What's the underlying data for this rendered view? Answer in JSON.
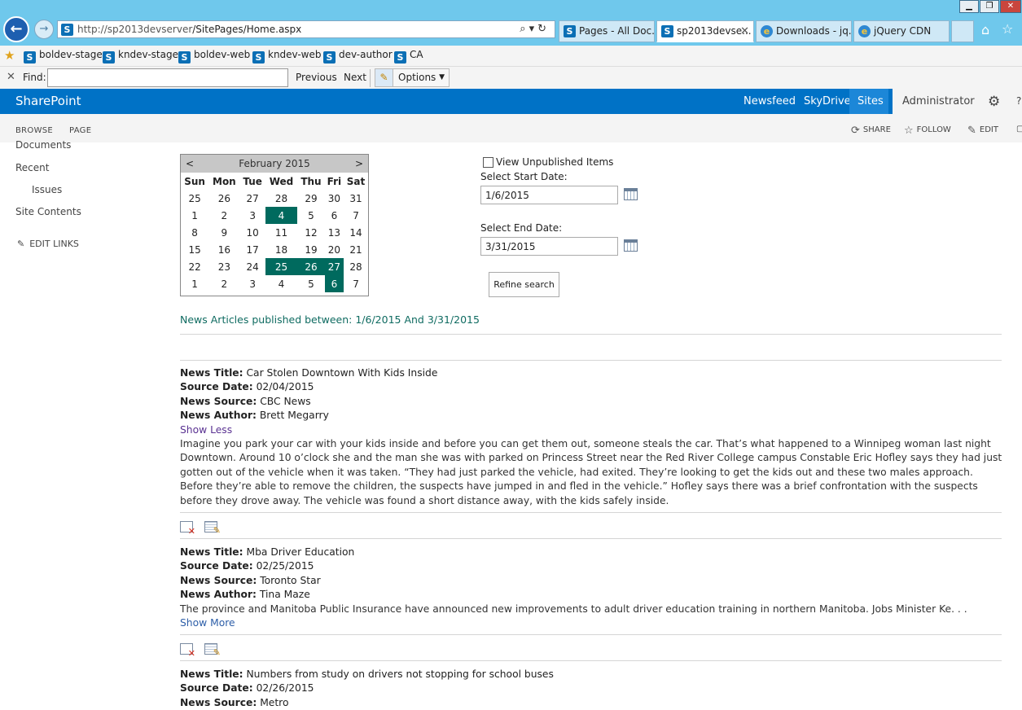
{
  "browser": {
    "url_host": "http://sp2013devserver",
    "url_path": "/SitePages/Home.aspx",
    "tabs": [
      {
        "label": "Pages - All Doc...",
        "active": false,
        "icon": "sharepoint-icon"
      },
      {
        "label": "sp2013devse...",
        "active": true,
        "icon": "sharepoint-icon"
      },
      {
        "label": "Downloads - jq...",
        "active": false,
        "icon": "ie-icon"
      },
      {
        "label": "jQuery CDN",
        "active": false,
        "icon": "ie-icon"
      }
    ],
    "favorites": [
      "boldev-stage",
      "kndev-stage",
      "boldev-web",
      "kndev-web",
      "dev-author",
      "CA"
    ],
    "find": {
      "label": "Find:",
      "value": "",
      "previous": "Previous",
      "next": "Next",
      "options": "Options"
    }
  },
  "suite": {
    "brand": "SharePoint",
    "links": [
      "Newsfeed",
      "SkyDrive",
      "Sites"
    ],
    "user": "Administrator"
  },
  "ribbon": {
    "tabs": [
      "BROWSE",
      "PAGE"
    ],
    "actions": [
      "SHARE",
      "FOLLOW",
      "EDIT"
    ]
  },
  "leftnav": {
    "items": [
      "Documents",
      "Recent",
      "Issues",
      "Site Contents"
    ],
    "edit_links": "EDIT LINKS"
  },
  "calendar": {
    "prev": "<",
    "next": ">",
    "title": "February 2015",
    "weekdays": [
      "Sun",
      "Mon",
      "Tue",
      "Wed",
      "Thu",
      "Fri",
      "Sat"
    ],
    "weeks": [
      [
        "25",
        "26",
        "27",
        "28",
        "29",
        "30",
        "31"
      ],
      [
        "1",
        "2",
        "3",
        "4",
        "5",
        "6",
        "7"
      ],
      [
        "8",
        "9",
        "10",
        "11",
        "12",
        "13",
        "14"
      ],
      [
        "15",
        "16",
        "17",
        "18",
        "19",
        "20",
        "21"
      ],
      [
        "22",
        "23",
        "24",
        "25",
        "26",
        "27",
        "28"
      ],
      [
        "1",
        "2",
        "3",
        "4",
        "5",
        "6",
        "7"
      ]
    ],
    "highlighted": [
      [
        1,
        3
      ],
      [
        4,
        3
      ],
      [
        4,
        4
      ],
      [
        4,
        5
      ],
      [
        5,
        5
      ]
    ],
    "highlight_color": "#006a5e"
  },
  "filters": {
    "unpublished_label": "View Unpublished Items",
    "unpublished_checked": false,
    "start_label": "Select Start Date:",
    "start_value": "1/6/2015",
    "end_label": "Select End Date:",
    "end_value": "3/31/2015",
    "refine_button": "Refine search"
  },
  "results_heading": "News Articles published between: 1/6/2015 And 3/31/2015",
  "field_labels": {
    "title": "News Title:",
    "date": "Source Date:",
    "source": "News Source:",
    "author": "News Author:"
  },
  "articles": [
    {
      "title": "Car Stolen Downtown With Kids Inside",
      "date": "02/04/2015",
      "source": "CBC News",
      "author": "Brett Megarry",
      "toggle": "Show Less",
      "body": "Imagine you park your car with your kids inside and before you can get them out, someone steals the car. That’s what happened to a Winnipeg woman last night Downtown. Around 10 o’clock she and the man she was with parked on Princess Street near the Red River College campus Constable Eric Hofley says they had just gotten out of the vehicle when it was taken. “They had just parked the vehicle, had exited. They’re looking to get the kids out and these two males approach. Before they’re able to remove the children, the suspects have jumped in and fled in the vehicle.” Hofley says there was a brief confrontation with the suspects before they drove away. The vehicle was found a short distance away, with the kids safely inside."
    },
    {
      "title": "Mba Driver Education",
      "date": "02/25/2015",
      "source": "Toronto Star",
      "author": "Tina Maze",
      "toggle": "Show More",
      "body": "The province and Manitoba Public Insurance have announced new improvements to adult driver education training in northern Manitoba. Jobs Minister Ke. . ."
    },
    {
      "title": "Numbers from study on drivers not stopping for school buses",
      "date": "02/26/2015",
      "source": "Metro"
    }
  ]
}
